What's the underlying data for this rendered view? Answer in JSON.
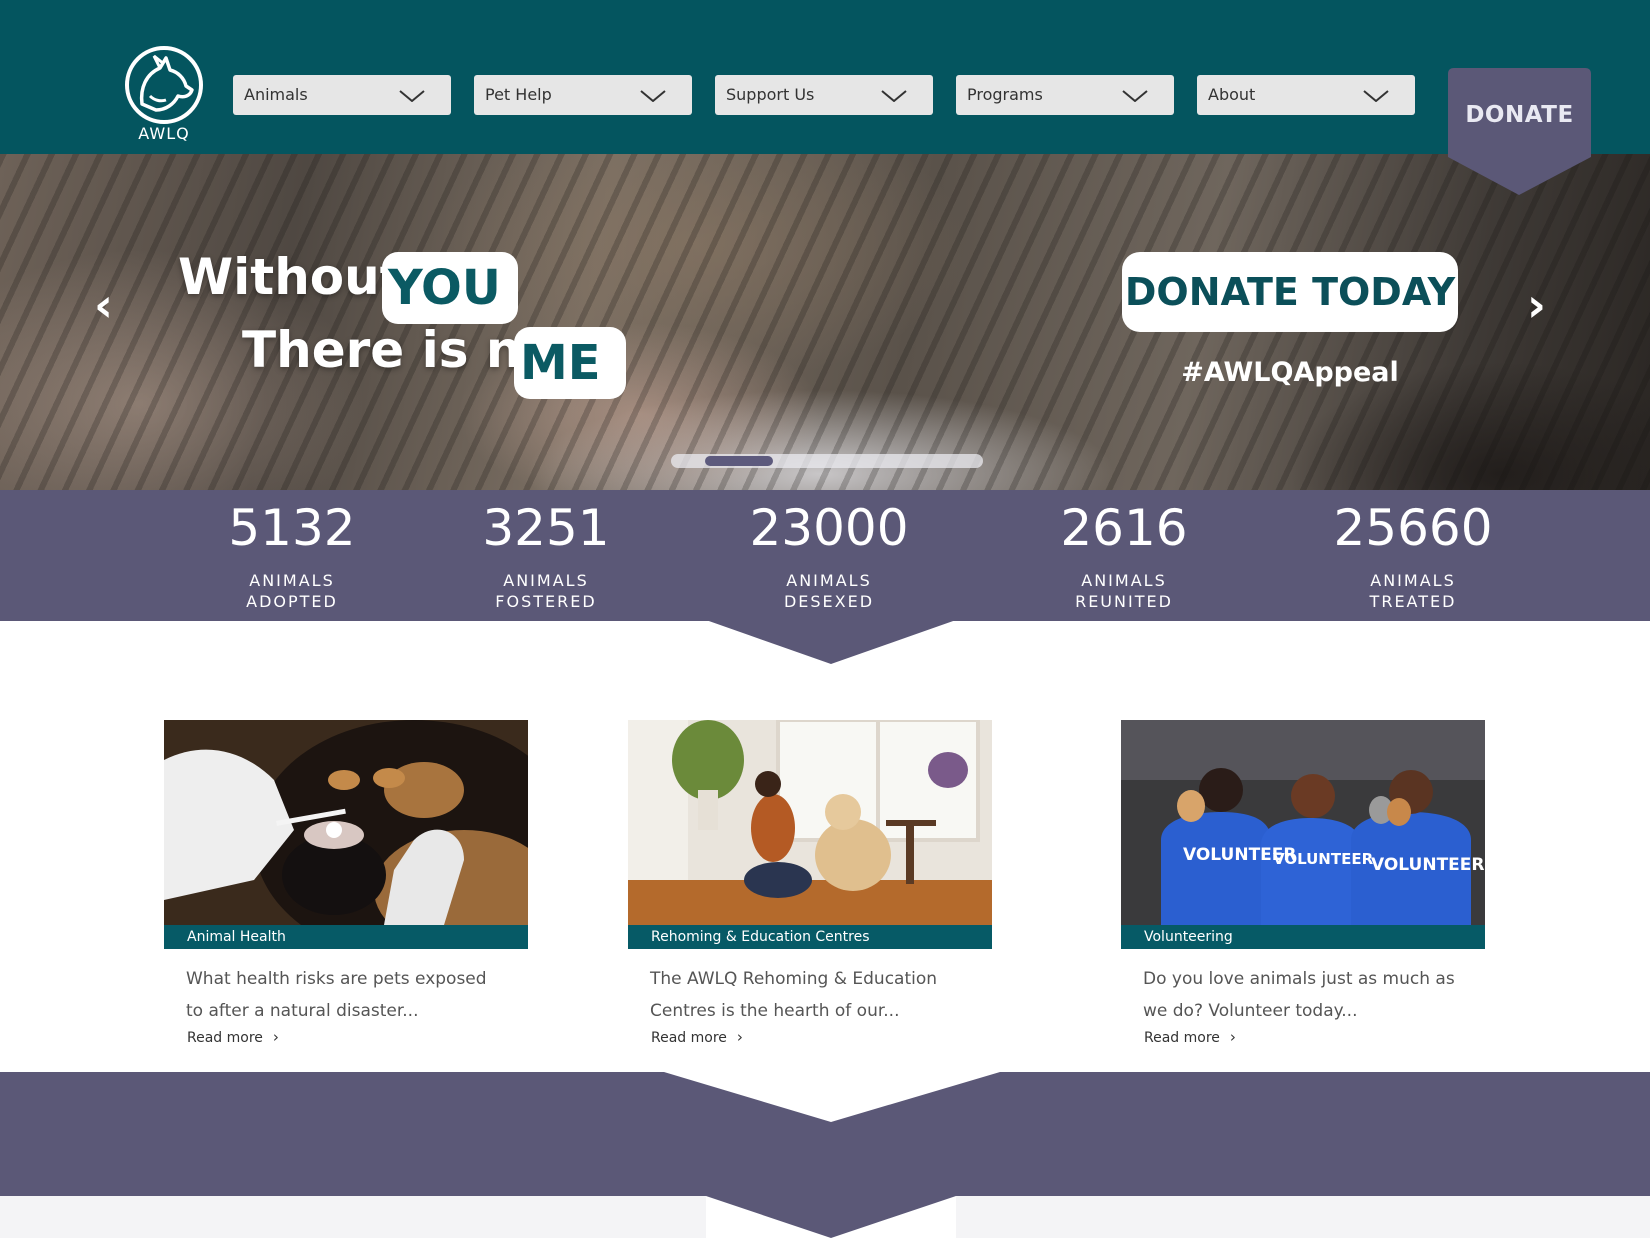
{
  "header": {
    "logo_text": "AWLQ",
    "nav": [
      {
        "label": "Animals"
      },
      {
        "label": "Pet Help"
      },
      {
        "label": "Support Us"
      },
      {
        "label": "Programs"
      },
      {
        "label": "About"
      }
    ],
    "donate_label": "DONATE"
  },
  "hero": {
    "line1": "Without",
    "pill1": "YOU",
    "line2": "There is no",
    "pill2": "ME",
    "cta": "DONATE TODAY",
    "hashtag": "#AWLQAppeal",
    "prev_icon": "‹",
    "next_icon": "›",
    "active_slide_fraction": 0.25
  },
  "stats": [
    {
      "value": "5132",
      "label": "ANIMALS ADOPTED"
    },
    {
      "value": "3251",
      "label": "ANIMALS FOSTERED"
    },
    {
      "value": "23000",
      "label": "ANIMALS DESEXED"
    },
    {
      "value": "2616",
      "label": "ANIMALS REUNITED"
    },
    {
      "value": "25660",
      "label": "ANIMALS TREATED"
    }
  ],
  "cards": [
    {
      "tag": "Animal Health",
      "text": "What health risks are pets exposed to after a natural disaster...",
      "more": "Read more",
      "image_icon": "vet-treating-dog-image"
    },
    {
      "tag": "Rehoming & Education Centres",
      "text": "The AWLQ Rehoming & Education Centres is the hearth of our...",
      "more": "Read more",
      "image_icon": "woman-with-dog-image"
    },
    {
      "tag": "Volunteering",
      "text": "Do you love animals just as much as we do? Volunteer today...",
      "more": "Read more",
      "image_icon": "volunteers-with-kittens-image",
      "shirt_text": "VOLUNTEER"
    }
  ],
  "colors": {
    "header_teal": "#04555f",
    "accent_purple": "#5b5877",
    "tag_teal": "#065a66"
  }
}
